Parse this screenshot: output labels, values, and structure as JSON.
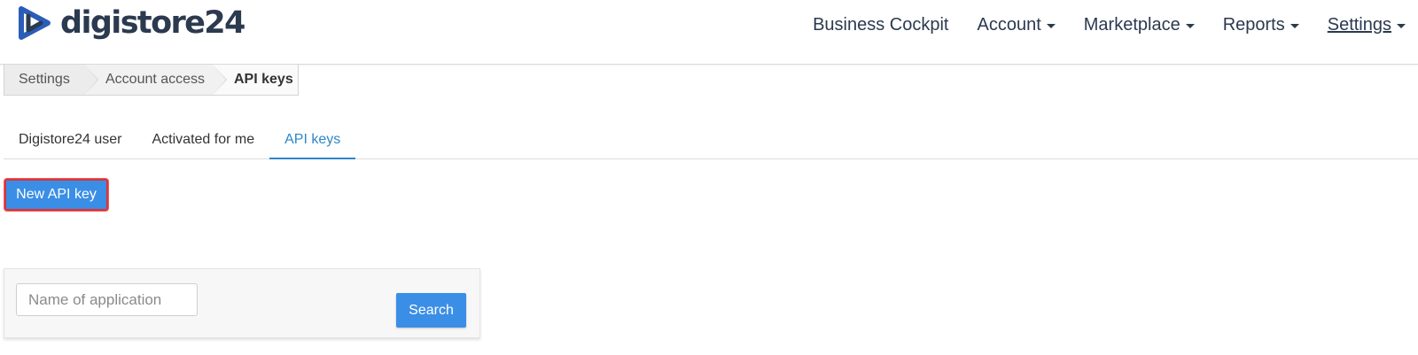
{
  "brand": {
    "name": "digistore24",
    "accent": "#2b5db8",
    "text_color": "#2b3a4f"
  },
  "nav": {
    "items": [
      {
        "label": "Business Cockpit",
        "dropdown": false
      },
      {
        "label": "Account",
        "dropdown": true
      },
      {
        "label": "Marketplace",
        "dropdown": true
      },
      {
        "label": "Reports",
        "dropdown": true
      },
      {
        "label": "Settings",
        "dropdown": true,
        "active": true
      }
    ]
  },
  "breadcrumb": [
    "Settings",
    "Account access",
    "API keys"
  ],
  "tabs": [
    {
      "label": "Digistore24 user",
      "active": false
    },
    {
      "label": "Activated for me",
      "active": false
    },
    {
      "label": "API keys",
      "active": true
    }
  ],
  "actions": {
    "new_api_key": "New API key"
  },
  "search": {
    "placeholder": "Name of application",
    "value": "",
    "button_label": "Search"
  },
  "colors": {
    "primary": "#3a8ee6",
    "tab_active": "#2d86c8",
    "highlight_border": "#d9343a"
  }
}
